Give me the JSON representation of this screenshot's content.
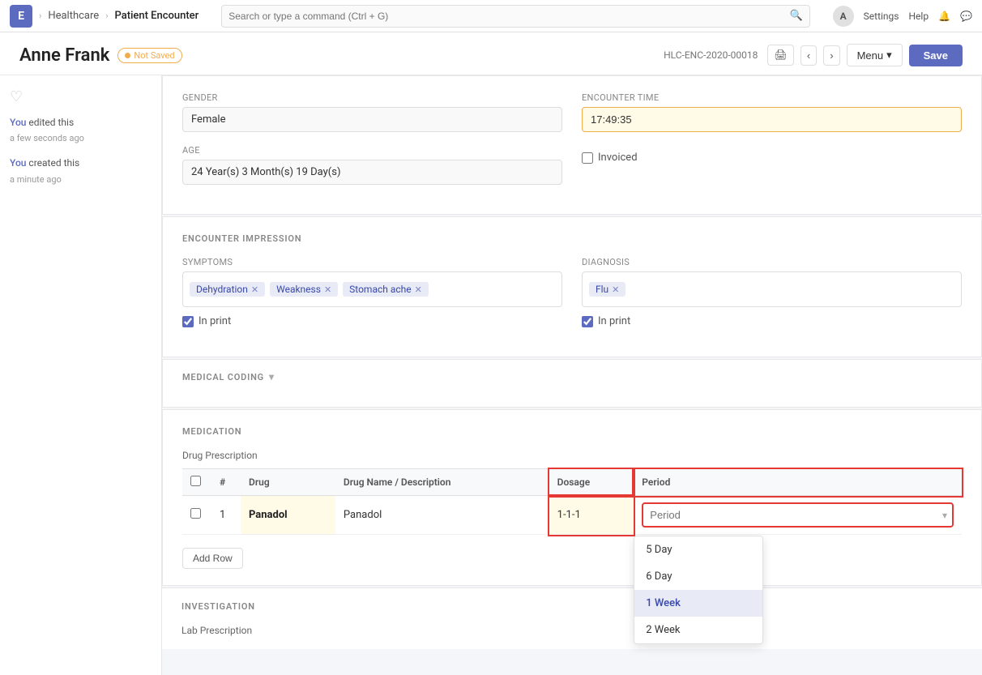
{
  "nav": {
    "logo": "E",
    "breadcrumbs": [
      "Healthcare",
      "Patient Encounter"
    ],
    "search_placeholder": "Search or type a command (Ctrl + G)",
    "settings_label": "Settings",
    "help_label": "Help",
    "avatar_label": "A"
  },
  "header": {
    "patient_name": "Anne Frank",
    "status": "Not Saved",
    "record_id": "HLC-ENC-2020-00018",
    "menu_label": "Menu",
    "save_label": "Save"
  },
  "sidebar": {
    "log": [
      {
        "actor": "You",
        "action": "edited this",
        "time": "a few seconds ago"
      },
      {
        "actor": "You",
        "action": "created this",
        "time": "a minute ago"
      }
    ]
  },
  "patient_info": {
    "gender_label": "Gender",
    "gender_value": "Female",
    "encounter_time_label": "Encounter Time",
    "encounter_time_value": "17:49:35",
    "age_label": "Age",
    "age_value": "24 Year(s) 3 Month(s) 19 Day(s)",
    "invoiced_label": "Invoiced"
  },
  "encounter_impression": {
    "section_label": "ENCOUNTER IMPRESSION",
    "symptoms_label": "Symptoms",
    "symptoms": [
      "Dehydration",
      "Weakness",
      "Stomach ache"
    ],
    "diagnosis_label": "Diagnosis",
    "diagnosis": [
      "Flu"
    ],
    "in_print_label": "In print",
    "in_print_checked": true,
    "diag_in_print_label": "In print",
    "diag_in_print_checked": true
  },
  "medical_coding": {
    "section_label": "MEDICAL CODING"
  },
  "medication": {
    "section_label": "MEDICATION",
    "drug_prescription_label": "Drug Prescription",
    "table_headers": [
      "",
      "#",
      "Drug",
      "Drug Name / Description",
      "Dosage",
      "Period"
    ],
    "rows": [
      {
        "num": 1,
        "drug": "Panadol",
        "description": "Panadol",
        "dosage": "1-1-1",
        "period": ""
      }
    ],
    "add_row_label": "Add Row",
    "period_placeholder": "Period",
    "period_options": [
      "5 Day",
      "6 Day",
      "1 Week",
      "2 Week"
    ]
  },
  "investigation": {
    "section_label": "INVESTIGATION",
    "sub_label": "Lab Prescription"
  }
}
